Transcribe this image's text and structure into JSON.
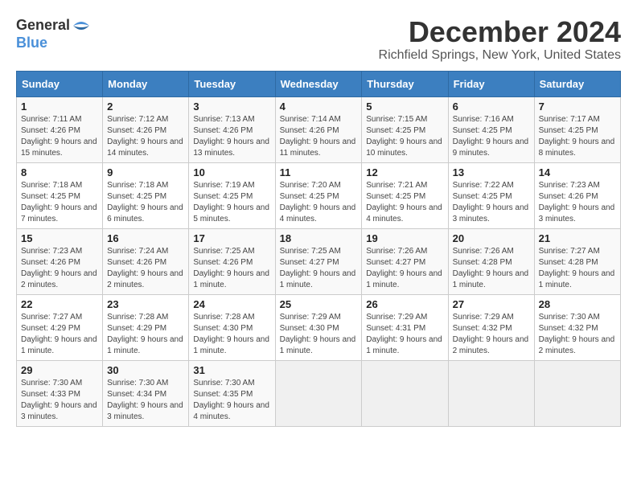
{
  "header": {
    "logo_general": "General",
    "logo_blue": "Blue",
    "month_title": "December 2024",
    "location": "Richfield Springs, New York, United States"
  },
  "weekdays": [
    "Sunday",
    "Monday",
    "Tuesday",
    "Wednesday",
    "Thursday",
    "Friday",
    "Saturday"
  ],
  "weeks": [
    [
      {
        "day": "1",
        "sunrise": "7:11 AM",
        "sunset": "4:26 PM",
        "daylight": "9 hours and 15 minutes."
      },
      {
        "day": "2",
        "sunrise": "7:12 AM",
        "sunset": "4:26 PM",
        "daylight": "9 hours and 14 minutes."
      },
      {
        "day": "3",
        "sunrise": "7:13 AM",
        "sunset": "4:26 PM",
        "daylight": "9 hours and 13 minutes."
      },
      {
        "day": "4",
        "sunrise": "7:14 AM",
        "sunset": "4:26 PM",
        "daylight": "9 hours and 11 minutes."
      },
      {
        "day": "5",
        "sunrise": "7:15 AM",
        "sunset": "4:25 PM",
        "daylight": "9 hours and 10 minutes."
      },
      {
        "day": "6",
        "sunrise": "7:16 AM",
        "sunset": "4:25 PM",
        "daylight": "9 hours and 9 minutes."
      },
      {
        "day": "7",
        "sunrise": "7:17 AM",
        "sunset": "4:25 PM",
        "daylight": "9 hours and 8 minutes."
      }
    ],
    [
      {
        "day": "8",
        "sunrise": "7:18 AM",
        "sunset": "4:25 PM",
        "daylight": "9 hours and 7 minutes."
      },
      {
        "day": "9",
        "sunrise": "7:18 AM",
        "sunset": "4:25 PM",
        "daylight": "9 hours and 6 minutes."
      },
      {
        "day": "10",
        "sunrise": "7:19 AM",
        "sunset": "4:25 PM",
        "daylight": "9 hours and 5 minutes."
      },
      {
        "day": "11",
        "sunrise": "7:20 AM",
        "sunset": "4:25 PM",
        "daylight": "9 hours and 4 minutes."
      },
      {
        "day": "12",
        "sunrise": "7:21 AM",
        "sunset": "4:25 PM",
        "daylight": "9 hours and 4 minutes."
      },
      {
        "day": "13",
        "sunrise": "7:22 AM",
        "sunset": "4:25 PM",
        "daylight": "9 hours and 3 minutes."
      },
      {
        "day": "14",
        "sunrise": "7:23 AM",
        "sunset": "4:26 PM",
        "daylight": "9 hours and 3 minutes."
      }
    ],
    [
      {
        "day": "15",
        "sunrise": "7:23 AM",
        "sunset": "4:26 PM",
        "daylight": "9 hours and 2 minutes."
      },
      {
        "day": "16",
        "sunrise": "7:24 AM",
        "sunset": "4:26 PM",
        "daylight": "9 hours and 2 minutes."
      },
      {
        "day": "17",
        "sunrise": "7:25 AM",
        "sunset": "4:26 PM",
        "daylight": "9 hours and 1 minute."
      },
      {
        "day": "18",
        "sunrise": "7:25 AM",
        "sunset": "4:27 PM",
        "daylight": "9 hours and 1 minute."
      },
      {
        "day": "19",
        "sunrise": "7:26 AM",
        "sunset": "4:27 PM",
        "daylight": "9 hours and 1 minute."
      },
      {
        "day": "20",
        "sunrise": "7:26 AM",
        "sunset": "4:28 PM",
        "daylight": "9 hours and 1 minute."
      },
      {
        "day": "21",
        "sunrise": "7:27 AM",
        "sunset": "4:28 PM",
        "daylight": "9 hours and 1 minute."
      }
    ],
    [
      {
        "day": "22",
        "sunrise": "7:27 AM",
        "sunset": "4:29 PM",
        "daylight": "9 hours and 1 minute."
      },
      {
        "day": "23",
        "sunrise": "7:28 AM",
        "sunset": "4:29 PM",
        "daylight": "9 hours and 1 minute."
      },
      {
        "day": "24",
        "sunrise": "7:28 AM",
        "sunset": "4:30 PM",
        "daylight": "9 hours and 1 minute."
      },
      {
        "day": "25",
        "sunrise": "7:29 AM",
        "sunset": "4:30 PM",
        "daylight": "9 hours and 1 minute."
      },
      {
        "day": "26",
        "sunrise": "7:29 AM",
        "sunset": "4:31 PM",
        "daylight": "9 hours and 1 minute."
      },
      {
        "day": "27",
        "sunrise": "7:29 AM",
        "sunset": "4:32 PM",
        "daylight": "9 hours and 2 minutes."
      },
      {
        "day": "28",
        "sunrise": "7:30 AM",
        "sunset": "4:32 PM",
        "daylight": "9 hours and 2 minutes."
      }
    ],
    [
      {
        "day": "29",
        "sunrise": "7:30 AM",
        "sunset": "4:33 PM",
        "daylight": "9 hours and 3 minutes."
      },
      {
        "day": "30",
        "sunrise": "7:30 AM",
        "sunset": "4:34 PM",
        "daylight": "9 hours and 3 minutes."
      },
      {
        "day": "31",
        "sunrise": "7:30 AM",
        "sunset": "4:35 PM",
        "daylight": "9 hours and 4 minutes."
      },
      null,
      null,
      null,
      null
    ]
  ],
  "labels": {
    "sunrise": "Sunrise:",
    "sunset": "Sunset:",
    "daylight": "Daylight:"
  }
}
